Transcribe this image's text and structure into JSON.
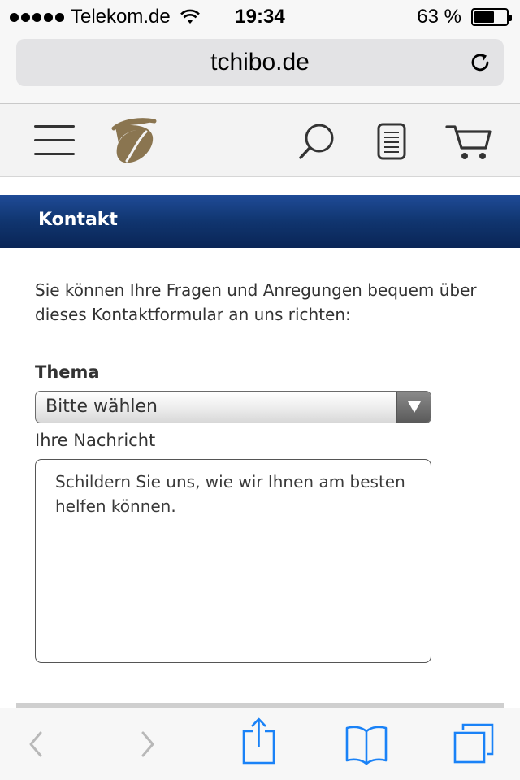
{
  "status_bar": {
    "carrier": "Telekom.de",
    "time": "19:34",
    "battery_percent": "63 %",
    "battery_level": 0.63
  },
  "browser": {
    "url": "tchibo.de"
  },
  "header": {
    "icons": [
      "menu-icon",
      "tchibo-logo",
      "search-icon",
      "list-icon",
      "cart-icon"
    ]
  },
  "banner": {
    "title": "Kontakt"
  },
  "form": {
    "intro": "Sie können Ihre Fragen und Anregungen bequem über dieses Kontaktformular an uns richten:",
    "topic_label": "Thema",
    "topic_selected": "Bitte wählen",
    "message_label": "Ihre Nachricht",
    "message_placeholder": "Schildern Sie uns, wie wir Ihnen am besten helfen können."
  },
  "toolbar": {
    "icons": [
      "back-icon",
      "forward-icon",
      "share-icon",
      "bookmarks-icon",
      "tabs-icon"
    ]
  },
  "colors": {
    "banner": "#10356f",
    "ios_blue": "#1a82f7",
    "logo_gold": "#8a7550"
  }
}
